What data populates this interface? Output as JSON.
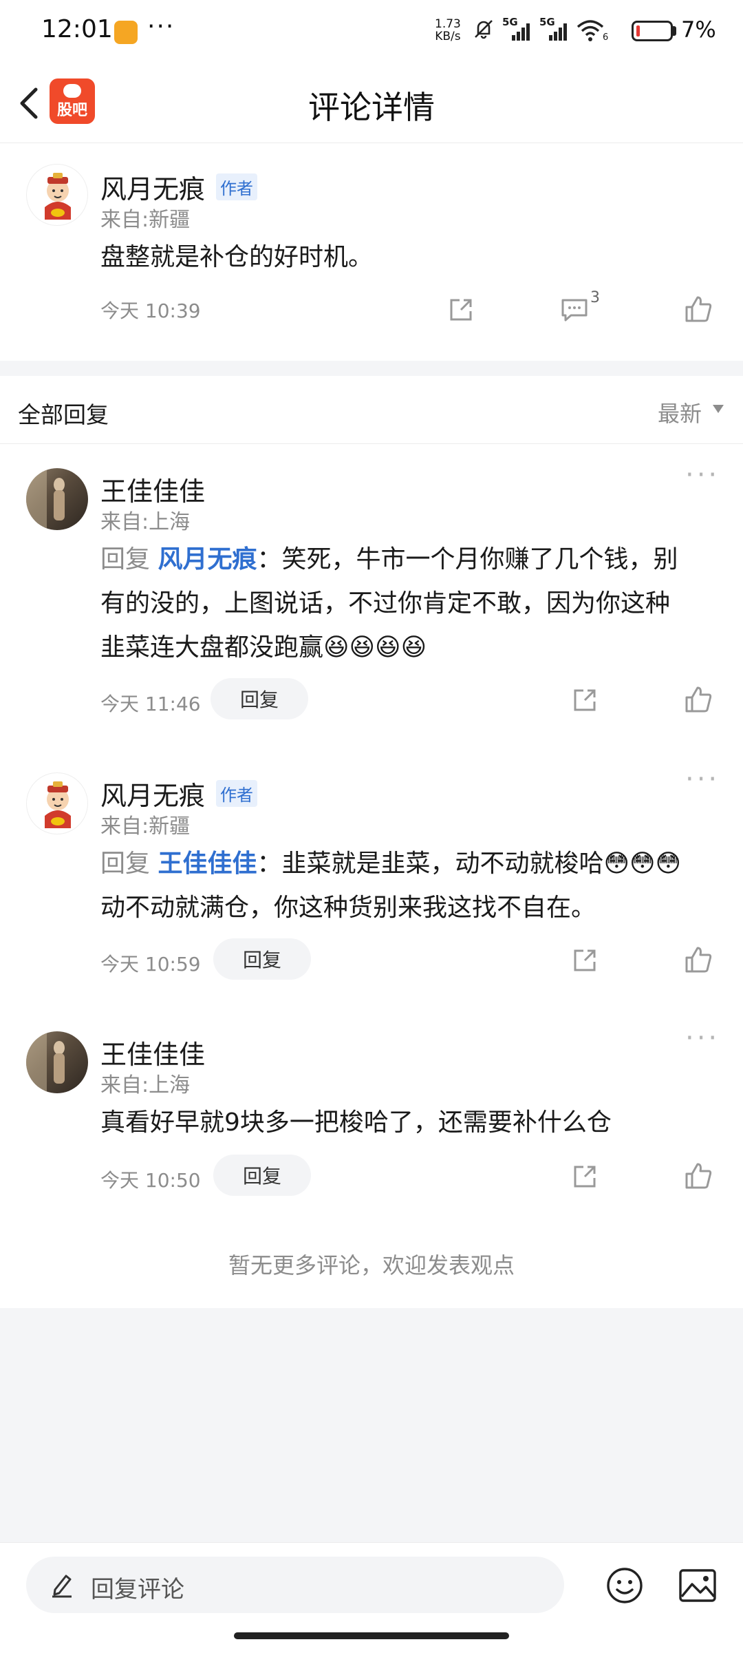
{
  "status_bar": {
    "time": "12:01",
    "dots": "···",
    "net_speed_value": "1.73",
    "net_speed_unit": "KB/s",
    "signal_1_label": "5G",
    "signal_2_label": "5G",
    "wifi_sub": "6",
    "battery_pct": "7%",
    "battery_level": 0.07
  },
  "header": {
    "title": "评论详情",
    "app_logo_text": "股吧"
  },
  "post": {
    "username": "风月无痕",
    "badge": "作者",
    "location": "来自:新疆",
    "content": "盘整就是补仓的好时机。",
    "time": "今天 10:39",
    "reply_count": "3"
  },
  "section": {
    "title": "全部回复",
    "sort_label": "最新"
  },
  "replies": [
    {
      "username": "王佳佳佳",
      "location": "来自:上海",
      "reply_prefix": "回复",
      "mention": "风月无痕",
      "line1": "：笑死，牛市一个月你赚了几个钱，别",
      "line2": "有的没的，上图说话，不过你肯定不敢，因为你这种",
      "line3": "韭菜连大盘都没跑赢😆😆😆😆",
      "time": "今天 11:46",
      "reply_label": "回复"
    },
    {
      "username": "风月无痕",
      "badge": "作者",
      "location": "来自:新疆",
      "reply_prefix": "回复",
      "mention": "王佳佳佳",
      "line1": "：韭菜就是韭菜，动不动就梭哈😳😳😳",
      "line2": "动不动就满仓，你这种货别来我这找不自在。",
      "time": "今天 10:59",
      "reply_label": "回复"
    },
    {
      "username": "王佳佳佳",
      "location": "来自:上海",
      "content": "真看好早就9块多一把梭哈了，还需要补什么仓",
      "time": "今天 10:50",
      "reply_label": "回复"
    }
  ],
  "footer_note": "暂无更多评论，欢迎发表观点",
  "bottom_bar": {
    "input_placeholder": "回复评论"
  },
  "colors": {
    "accent_blue": "#2f6fd0",
    "logo_red": "#f04a2a",
    "muted_gray": "#8c8c8c"
  },
  "icons": [
    "back-arrow-icon",
    "share-icon",
    "comment-icon",
    "like-icon",
    "more-dots-icon",
    "edit-icon",
    "emoji-icon",
    "image-icon",
    "sort-caret-icon"
  ]
}
